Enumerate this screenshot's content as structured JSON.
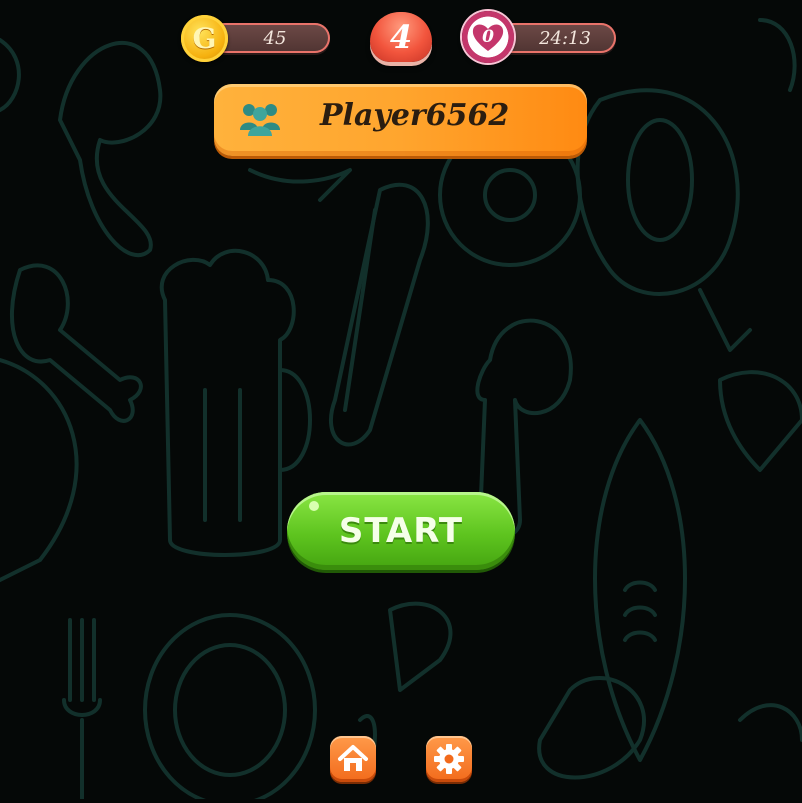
{
  "hud": {
    "coins": "45",
    "coin_symbol": "G",
    "level": "4",
    "lives": "0",
    "timer": "24:13"
  },
  "player": {
    "name": "Player6562"
  },
  "start_button": {
    "label": "START"
  },
  "bottom_bar": {
    "home_icon": "home-icon",
    "settings_icon": "gear-icon"
  },
  "colors": {
    "background": "#050807",
    "doodle_lines": "#12302b",
    "banner_orange": "#ffa52e",
    "start_green": "#5ec41f",
    "button_orange": "#f26a1b"
  }
}
